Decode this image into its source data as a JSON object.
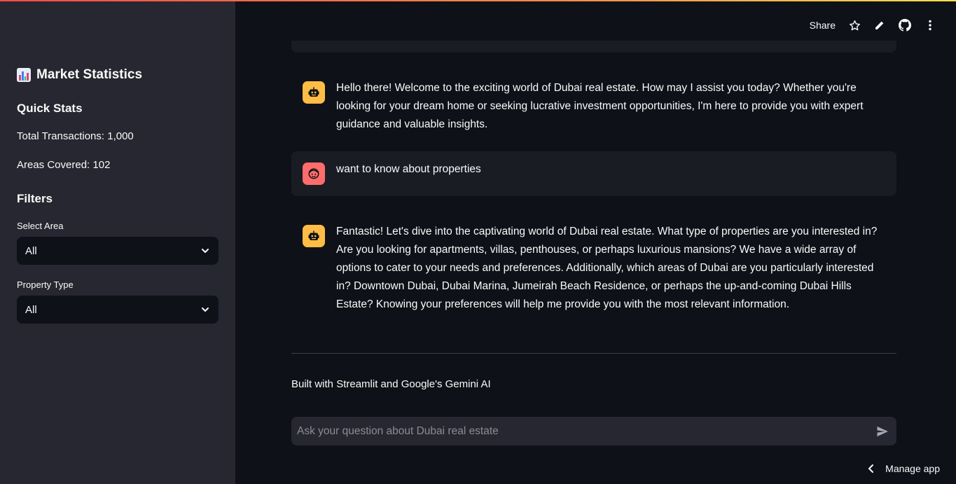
{
  "sidebar": {
    "title": "Market Statistics",
    "title_icon": "bar-chart-emoji",
    "quick_stats_heading": "Quick Stats",
    "total_transactions": "Total Transactions: 1,000",
    "areas_covered": "Areas Covered: 102",
    "filters_heading": "Filters",
    "select_area": {
      "label": "Select Area",
      "value": "All"
    },
    "property_type": {
      "label": "Property Type",
      "value": "All"
    }
  },
  "header": {
    "share_label": "Share",
    "icons": [
      "star-icon",
      "edit-pencil-icon",
      "github-icon",
      "more-menu-icon"
    ]
  },
  "chat": {
    "messages": [
      {
        "role": "assistant",
        "text": "Hello there! Welcome to the exciting world of Dubai real estate. How may I assist you today? Whether you're looking for your dream home or seeking lucrative investment opportunities, I'm here to provide you with expert guidance and valuable insights."
      },
      {
        "role": "user",
        "text": "want to know about properties"
      },
      {
        "role": "assistant",
        "text": "Fantastic! Let's dive into the captivating world of Dubai real estate. What type of properties are you interested in? Are you looking for apartments, villas, penthouses, or perhaps luxurious mansions? We have a wide array of options to cater to your needs and preferences. Additionally, which areas of Dubai are you particularly interested in? Downtown Dubai, Dubai Marina, Jumeirah Beach Residence, or perhaps the up-and-coming Dubai Hills Estate? Knowing your preferences will help me provide you with the most relevant information."
      }
    ],
    "footer": "Built with Streamlit and Google's Gemini AI",
    "input_placeholder": "Ask your question about Dubai real estate"
  },
  "manage_app_label": "Manage app",
  "colors": {
    "background": "#0e1117",
    "sidebar": "#262730",
    "assistant_avatar": "#ffbd45",
    "user_avatar": "#ff6c6c"
  }
}
